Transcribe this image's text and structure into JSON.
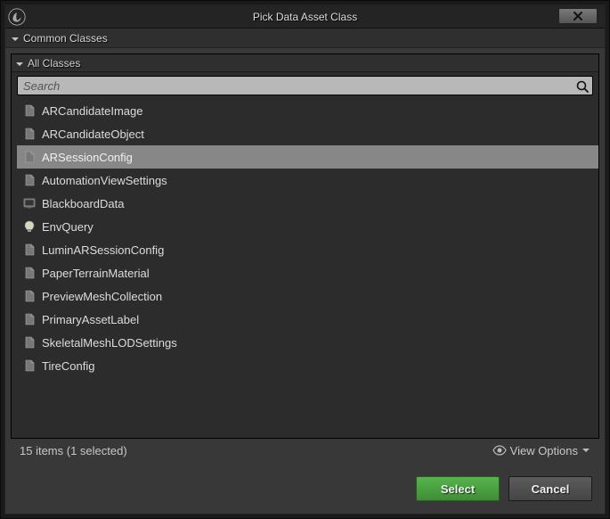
{
  "title": "Pick Data Asset Class",
  "sections": {
    "common": "Common Classes",
    "all": "All Classes"
  },
  "search": {
    "placeholder": "Search"
  },
  "classes": [
    {
      "name": "ARCandidateImage",
      "icon": "data",
      "selected": false
    },
    {
      "name": "ARCandidateObject",
      "icon": "data",
      "selected": false
    },
    {
      "name": "ARSessionConfig",
      "icon": "data",
      "selected": true
    },
    {
      "name": "AutomationViewSettings",
      "icon": "data",
      "selected": false
    },
    {
      "name": "BlackboardData",
      "icon": "board",
      "selected": false
    },
    {
      "name": "EnvQuery",
      "icon": "bulb",
      "selected": false
    },
    {
      "name": "LuminARSessionConfig",
      "icon": "data",
      "selected": false
    },
    {
      "name": "PaperTerrainMaterial",
      "icon": "data",
      "selected": false
    },
    {
      "name": "PreviewMeshCollection",
      "icon": "data",
      "selected": false
    },
    {
      "name": "PrimaryAssetLabel",
      "icon": "data",
      "selected": false
    },
    {
      "name": "SkeletalMeshLODSettings",
      "icon": "data",
      "selected": false
    },
    {
      "name": "TireConfig",
      "icon": "data",
      "selected": false
    }
  ],
  "status": "15 items (1 selected)",
  "viewOptions": "View Options",
  "buttons": {
    "select": "Select",
    "cancel": "Cancel"
  }
}
